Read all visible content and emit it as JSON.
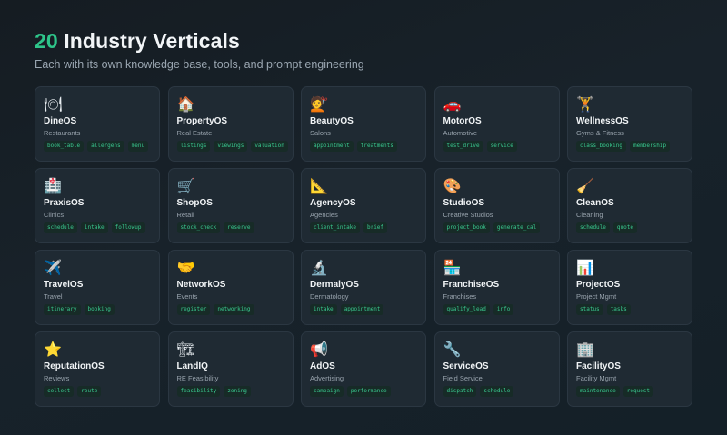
{
  "header": {
    "count": "20",
    "title": "Industry Verticals",
    "subtitle": "Each with its own knowledge base, tools, and prompt engineering"
  },
  "colors": {
    "accent": "#2ec58a",
    "tag_text": "#39c98f",
    "card_bg": "#1f2a33",
    "page_bg": "#18222a"
  },
  "verticals": [
    {
      "icon": "🍽",
      "icon_name": "dining-icon",
      "name": "DineOS",
      "category": "Restaurants",
      "tags": [
        "book_table",
        "allergens",
        "menu"
      ]
    },
    {
      "icon": "🏠",
      "icon_name": "house-icon",
      "name": "PropertyOS",
      "category": "Real Estate",
      "tags": [
        "listings",
        "viewings",
        "valuation"
      ]
    },
    {
      "icon": "💇",
      "icon_name": "haircut-icon",
      "name": "BeautyOS",
      "category": "Salons",
      "tags": [
        "appointment",
        "treatments"
      ]
    },
    {
      "icon": "🚗",
      "icon_name": "car-icon",
      "name": "MotorOS",
      "category": "Automotive",
      "tags": [
        "test_drive",
        "service"
      ]
    },
    {
      "icon": "🏋",
      "icon_name": "weightlifter-icon",
      "name": "WellnessOS",
      "category": "Gyms & Fitness",
      "tags": [
        "class_booking",
        "membership"
      ]
    },
    {
      "icon": "🏥",
      "icon_name": "hospital-icon",
      "name": "PraxisOS",
      "category": "Clinics",
      "tags": [
        "schedule",
        "intake",
        "followup"
      ]
    },
    {
      "icon": "🛒",
      "icon_name": "shopping-cart-icon",
      "name": "ShopOS",
      "category": "Retail",
      "tags": [
        "stock_check",
        "reserve"
      ]
    },
    {
      "icon": "📐",
      "icon_name": "triangle-ruler-icon",
      "name": "AgencyOS",
      "category": "Agencies",
      "tags": [
        "client_intake",
        "brief"
      ]
    },
    {
      "icon": "🎨",
      "icon_name": "palette-icon",
      "name": "StudioOS",
      "category": "Creative Studios",
      "tags": [
        "project_book",
        "generate_cal"
      ]
    },
    {
      "icon": "🧹",
      "icon_name": "broom-icon",
      "name": "CleanOS",
      "category": "Cleaning",
      "tags": [
        "schedule",
        "quote"
      ]
    },
    {
      "icon": "✈️",
      "icon_name": "airplane-icon",
      "name": "TravelOS",
      "category": "Travel",
      "tags": [
        "itinerary",
        "booking"
      ]
    },
    {
      "icon": "🤝",
      "icon_name": "handshake-icon",
      "name": "NetworkOS",
      "category": "Events",
      "tags": [
        "register",
        "networking"
      ]
    },
    {
      "icon": "🔬",
      "icon_name": "microscope-icon",
      "name": "DermalyOS",
      "category": "Dermatology",
      "tags": [
        "intake",
        "appointment"
      ]
    },
    {
      "icon": "🏪",
      "icon_name": "store-icon",
      "name": "FranchiseOS",
      "category": "Franchises",
      "tags": [
        "qualify_lead",
        "info"
      ]
    },
    {
      "icon": "📊",
      "icon_name": "bar-chart-icon",
      "name": "ProjectOS",
      "category": "Project Mgmt",
      "tags": [
        "status",
        "tasks"
      ]
    },
    {
      "icon": "⭐",
      "icon_name": "star-icon",
      "name": "ReputationOS",
      "category": "Reviews",
      "tags": [
        "collect",
        "route"
      ]
    },
    {
      "icon": "🏗",
      "icon_name": "construction-icon",
      "name": "LandIQ",
      "category": "RE Feasibility",
      "tags": [
        "feasibility",
        "zoning"
      ]
    },
    {
      "icon": "📢",
      "icon_name": "megaphone-icon",
      "name": "AdOS",
      "category": "Advertising",
      "tags": [
        "campaign",
        "performance"
      ]
    },
    {
      "icon": "🔧",
      "icon_name": "wrench-icon",
      "name": "ServiceOS",
      "category": "Field Service",
      "tags": [
        "dispatch",
        "schedule"
      ]
    },
    {
      "icon": "🏢",
      "icon_name": "office-building-icon",
      "name": "FacilityOS",
      "category": "Facility Mgmt",
      "tags": [
        "maintenance",
        "request"
      ]
    }
  ]
}
